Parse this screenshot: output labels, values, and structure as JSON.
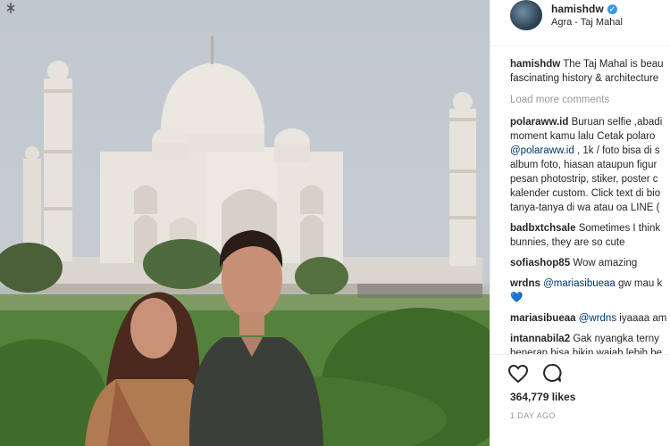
{
  "post": {
    "username": "hamishdw",
    "location": "Agra - Taj Mahal",
    "verified_glyph": "✓"
  },
  "caption": {
    "username": "hamishdw",
    "line1": "The Taj Mahal is beau",
    "line2": "fascinating history & architecture"
  },
  "load_more": "Load more comments",
  "comments": [
    {
      "user": "polaraww.id",
      "lines": [
        "Buruan selfie ,abadi",
        "moment kamu lalu Cetak polaro"
      ],
      "mention": "@polaraww.id",
      "rest": [
        " , 1k / foto bisa di s",
        "album foto, hiasan ataupun figur",
        "pesan photostrip, stiker, poster c",
        "kalender custom. Click text di bio",
        "tanya-tanya di wa atau oa LINE ("
      ]
    },
    {
      "user": "badbxtchsale",
      "text": "Sometimes I think",
      "line2": "bunnies, they are so cute"
    },
    {
      "user": "sofiashop85",
      "text": "Wow amazing"
    },
    {
      "user": "wrdns",
      "mention": "@mariasibueaa",
      "text": " gw mau k",
      "emoji": "💙"
    },
    {
      "user": "mariasibueaa",
      "mention": "@wrdns",
      "text": " iyaaaa am"
    },
    {
      "user": "intannabila2",
      "text": "Gak nyangka terny",
      "line2": "beneran bisa bikin wajah lebih be"
    }
  ],
  "likes": "364,779 likes",
  "date": "1 DAY AGO",
  "icons": {
    "like": "heart-icon",
    "comment": "comment-icon",
    "verified": "verified-badge-icon"
  },
  "colors": {
    "accent": "#3897f0",
    "mention": "#003569",
    "muted": "#999999"
  }
}
